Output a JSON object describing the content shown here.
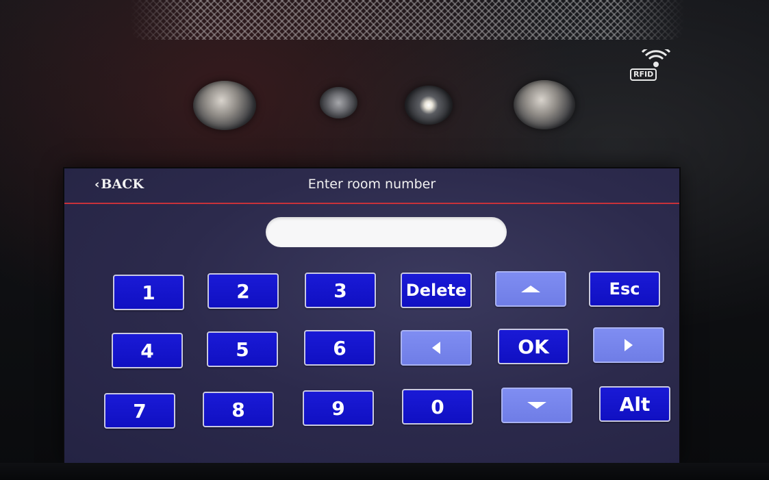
{
  "device": {
    "rfid_label": "RFID"
  },
  "screen": {
    "back_label": "BACK",
    "title": "Enter room number",
    "room_input": {
      "value": "",
      "placeholder": ""
    }
  },
  "keypad": {
    "k1": "1",
    "k2": "2",
    "k3": "3",
    "k4": "4",
    "k5": "5",
    "k6": "6",
    "k7": "7",
    "k8": "8",
    "k9": "9",
    "k0": "0",
    "delete": "Delete",
    "esc": "Esc",
    "ok": "OK",
    "alt": "Alt",
    "up_icon": "triangle-up-icon",
    "down_icon": "triangle-down-icon",
    "left_icon": "triangle-left-icon",
    "right_icon": "triangle-right-icon"
  },
  "colors": {
    "key_blue": "#1414cc",
    "nav_key": "#7583ec",
    "header_rule": "#c8323a",
    "screen_bg": "#2c2a4c"
  }
}
